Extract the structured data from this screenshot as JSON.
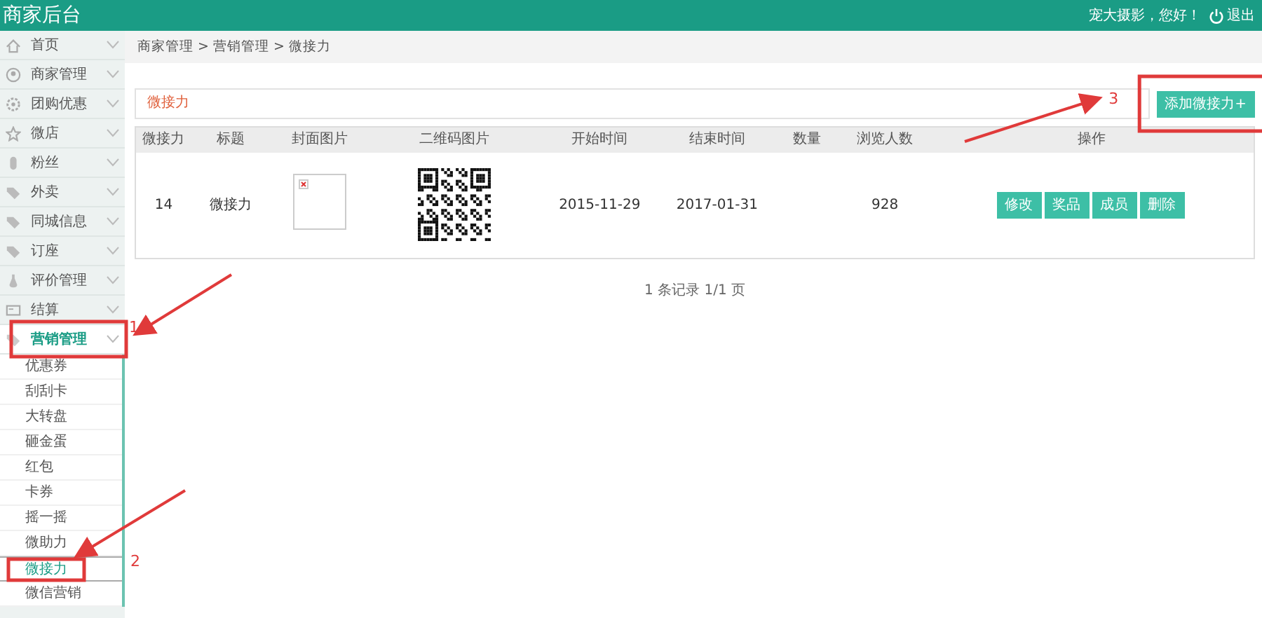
{
  "header": {
    "title": "商家后台",
    "greeting": "宠大摄影，您好！",
    "logout": "退出"
  },
  "sidebar": {
    "items": [
      {
        "label": "首页",
        "selected": false
      },
      {
        "label": "商家管理",
        "selected": false
      },
      {
        "label": "团购优惠",
        "selected": false
      },
      {
        "label": "微店",
        "selected": false
      },
      {
        "label": "粉丝",
        "selected": false
      },
      {
        "label": "外卖",
        "selected": false
      },
      {
        "label": "同城信息",
        "selected": false
      },
      {
        "label": "订座",
        "selected": false
      },
      {
        "label": "评价管理",
        "selected": false
      },
      {
        "label": "结算",
        "selected": false
      },
      {
        "label": "营销管理",
        "selected": true,
        "expanded": true,
        "children": [
          {
            "label": "优惠券",
            "selected": false
          },
          {
            "label": "刮刮卡",
            "selected": false
          },
          {
            "label": "大转盘",
            "selected": false
          },
          {
            "label": "砸金蛋",
            "selected": false
          },
          {
            "label": "红包",
            "selected": false
          },
          {
            "label": "卡券",
            "selected": false
          },
          {
            "label": "摇一摇",
            "selected": false
          },
          {
            "label": "微助力",
            "selected": false
          },
          {
            "label": "微接力",
            "selected": true
          },
          {
            "label": "微信营销",
            "selected": false
          }
        ]
      }
    ]
  },
  "breadcrumb": "商家管理 > 营销管理 > 微接力",
  "panel": {
    "title": "微接力",
    "add_button": "添加微接力+"
  },
  "table": {
    "columns": [
      "微接力",
      "标题",
      "封面图片",
      "二维码图片",
      "开始时间",
      "结束时间",
      "数量",
      "浏览人数",
      "操作"
    ],
    "rows": [
      {
        "id": "14",
        "title": "微接力",
        "start": "2015-11-29",
        "end": "2017-01-31",
        "views": "928",
        "actions": [
          "修改",
          "奖品",
          "成员",
          "删除"
        ]
      }
    ]
  },
  "pagination": "1 条记录 1/1 页",
  "annotations": [
    {
      "label": "1"
    },
    {
      "label": "2"
    },
    {
      "label": "3"
    }
  ]
}
